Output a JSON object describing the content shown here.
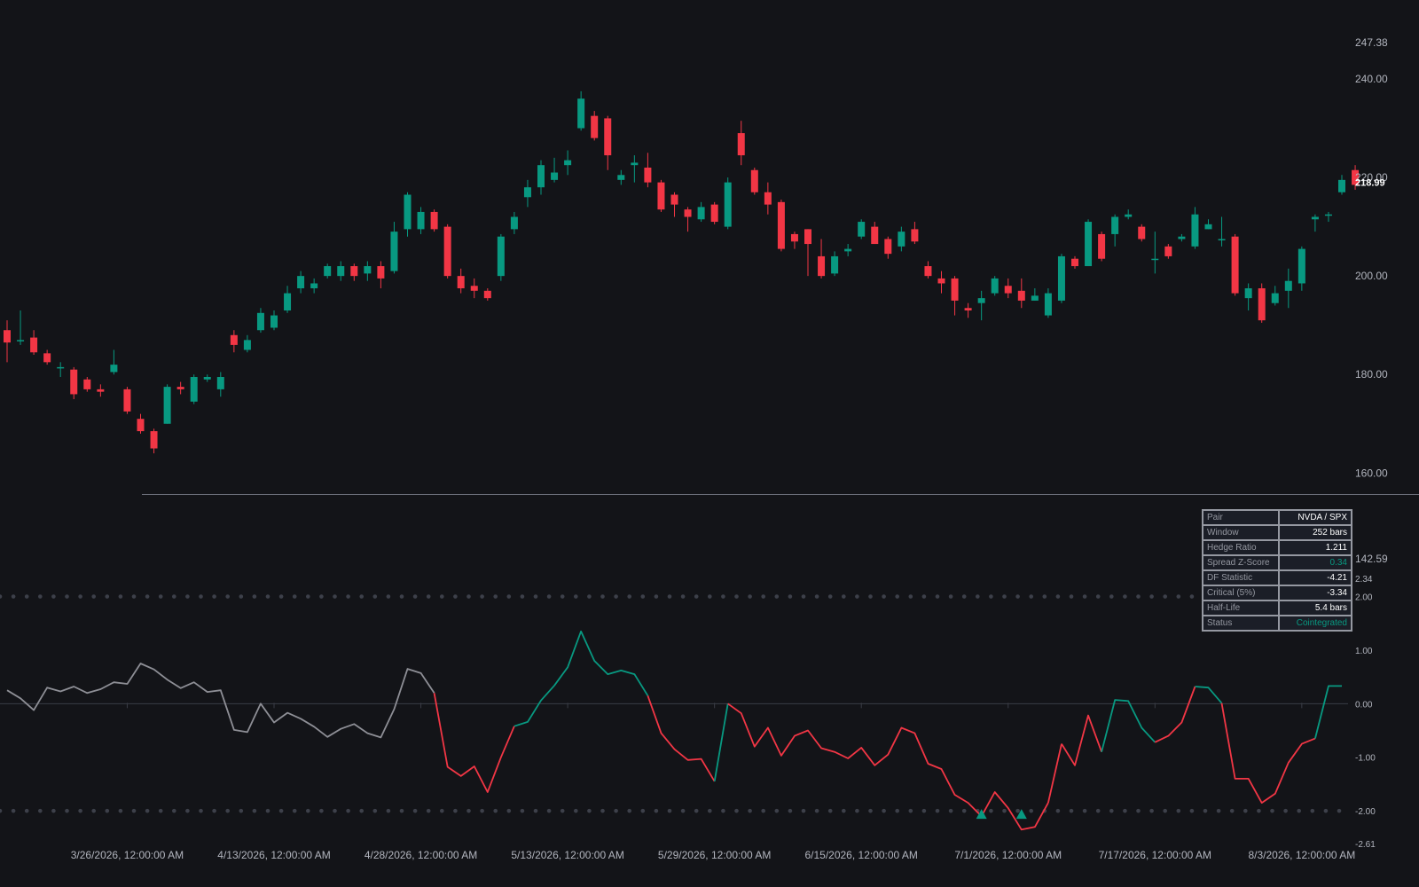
{
  "colors": {
    "background": "#131418",
    "up": "#089981",
    "down": "#f23645",
    "neutral": "#8e8f96",
    "grid": "#3a3d46",
    "band_dots": "#3d404a",
    "table_border": "#9598a1",
    "text": "#b2b5be"
  },
  "stats_table": {
    "rows": [
      {
        "label": "Pair",
        "value": "NVDA / SPX"
      },
      {
        "label": "Window",
        "value": "252 bars"
      },
      {
        "label": "Hedge Ratio",
        "value": "1.211"
      },
      {
        "label": "Spread Z-Score",
        "value": "0.34"
      },
      {
        "label": "DF Statistic",
        "value": "-4.21"
      },
      {
        "label": "Critical (5%)",
        "value": "-3.34"
      },
      {
        "label": "Half-Life",
        "value": "5.4 bars"
      },
      {
        "label": "Status",
        "value": "Cointegrated"
      }
    ]
  },
  "chart_data": [
    {
      "type": "candlestick",
      "title": "",
      "ylim": [
        142.59,
        247.38
      ],
      "y_ticks": [
        "247.38",
        "240.00",
        "220.00",
        "200.00",
        "180.00",
        "160.00",
        "142.59"
      ],
      "last_price": "218.99",
      "candles": [
        [
          189.0,
          186.5,
          191.0,
          182.5
        ],
        [
          187.0,
          187.0,
          193.0,
          186.0
        ],
        [
          187.5,
          184.5,
          189.0,
          184.0
        ],
        [
          184.3,
          182.5,
          185.0,
          182.0
        ],
        [
          181.5,
          181.5,
          182.5,
          179.5
        ],
        [
          181.0,
          176.0,
          181.5,
          175.0
        ],
        [
          179.0,
          177.0,
          179.5,
          176.5
        ],
        [
          177.0,
          176.5,
          178.0,
          175.5
        ],
        [
          180.5,
          182.0,
          185.0,
          180.0
        ],
        [
          177.0,
          172.5,
          177.5,
          172.0
        ],
        [
          171.0,
          168.5,
          172.0,
          168.0
        ],
        [
          168.5,
          165.0,
          169.0,
          164.0
        ],
        [
          170.0,
          177.5,
          178.0,
          170.0
        ],
        [
          177.5,
          177.0,
          178.5,
          176.0
        ],
        [
          174.5,
          179.5,
          180.0,
          174.0
        ],
        [
          179.0,
          179.5,
          180.0,
          178.5
        ],
        [
          177.0,
          179.5,
          180.5,
          175.5
        ],
        [
          188.0,
          186.0,
          189.0,
          184.5
        ],
        [
          185.0,
          187.0,
          188.0,
          184.5
        ],
        [
          189.0,
          192.5,
          193.5,
          188.5
        ],
        [
          189.5,
          192.0,
          193.0,
          189.0
        ],
        [
          193.0,
          196.5,
          198.0,
          192.5
        ],
        [
          197.5,
          200.0,
          201.0,
          196.5
        ],
        [
          197.5,
          198.5,
          199.5,
          196.5
        ],
        [
          200.0,
          202.0,
          202.5,
          199.5
        ],
        [
          200.0,
          202.0,
          203.0,
          199.0
        ],
        [
          202.0,
          200.0,
          202.5,
          199.0
        ],
        [
          200.5,
          202.0,
          203.0,
          199.0
        ],
        [
          202.0,
          199.5,
          203.0,
          197.5
        ],
        [
          201.0,
          209.0,
          211.0,
          200.5
        ],
        [
          209.5,
          216.5,
          217.0,
          208.0
        ],
        [
          209.5,
          213.0,
          214.0,
          208.5
        ],
        [
          213.0,
          209.5,
          213.5,
          209.0
        ],
        [
          210.0,
          200.0,
          210.5,
          199.5
        ],
        [
          200.0,
          197.5,
          201.5,
          196.5
        ],
        [
          198.0,
          197.0,
          199.5,
          195.5
        ],
        [
          197.0,
          195.5,
          197.5,
          195.0
        ],
        [
          200.0,
          208.0,
          208.5,
          199.0
        ],
        [
          209.5,
          212.0,
          213.0,
          208.5
        ],
        [
          216.0,
          218.0,
          219.5,
          214.0
        ],
        [
          218.0,
          222.5,
          223.5,
          216.5
        ],
        [
          219.5,
          221.0,
          224.0,
          219.0
        ],
        [
          222.5,
          223.5,
          225.5,
          220.5
        ],
        [
          230.0,
          236.0,
          237.5,
          229.5
        ],
        [
          232.5,
          228.0,
          233.5,
          227.5
        ],
        [
          232.0,
          224.5,
          232.5,
          221.5
        ],
        [
          219.5,
          220.5,
          221.5,
          218.5
        ],
        [
          222.5,
          223.0,
          224.5,
          219.0
        ],
        [
          222.0,
          219.0,
          225.0,
          218.0
        ],
        [
          219.0,
          213.5,
          219.5,
          213.0
        ],
        [
          216.5,
          214.5,
          217.0,
          212.0
        ],
        [
          213.5,
          212.0,
          214.0,
          209.0
        ],
        [
          211.5,
          214.0,
          215.0,
          211.0
        ],
        [
          214.5,
          211.0,
          215.0,
          210.5
        ],
        [
          210.0,
          219.0,
          220.0,
          209.5
        ],
        [
          229.0,
          224.5,
          231.5,
          222.5
        ],
        [
          221.5,
          217.0,
          222.0,
          216.5
        ],
        [
          217.0,
          214.5,
          219.0,
          212.5
        ],
        [
          215.0,
          205.5,
          215.5,
          205.0
        ],
        [
          208.5,
          207.0,
          209.0,
          205.5
        ],
        [
          209.5,
          206.5,
          209.5,
          200.0
        ],
        [
          204.0,
          200.0,
          207.5,
          199.5
        ],
        [
          200.5,
          204.0,
          205.0,
          200.0
        ],
        [
          205.0,
          205.5,
          206.5,
          204.0
        ],
        [
          208.0,
          211.0,
          211.5,
          207.5
        ],
        [
          210.0,
          206.5,
          211.0,
          206.5
        ],
        [
          207.5,
          204.5,
          208.0,
          203.5
        ],
        [
          206.0,
          209.0,
          210.0,
          205.0
        ],
        [
          209.5,
          207.0,
          211.0,
          206.5
        ],
        [
          202.0,
          200.0,
          203.0,
          199.5
        ],
        [
          199.5,
          198.5,
          201.0,
          196.5
        ],
        [
          199.5,
          195.0,
          200.0,
          192.0
        ],
        [
          193.5,
          193.0,
          194.5,
          191.5
        ],
        [
          194.5,
          195.5,
          197.0,
          191.0
        ],
        [
          196.5,
          199.5,
          200.0,
          196.0
        ],
        [
          198.0,
          196.5,
          199.5,
          195.5
        ],
        [
          197.0,
          195.0,
          199.5,
          193.5
        ],
        [
          195.0,
          196.0,
          197.5,
          195.0
        ],
        [
          192.0,
          196.5,
          197.5,
          191.5
        ],
        [
          195.0,
          204.0,
          204.5,
          194.5
        ],
        [
          203.5,
          202.0,
          204.0,
          201.5
        ],
        [
          202.0,
          211.0,
          211.5,
          202.0
        ],
        [
          208.5,
          203.5,
          209.0,
          203.0
        ],
        [
          208.5,
          212.0,
          212.5,
          206.0
        ],
        [
          212.0,
          212.5,
          213.5,
          211.5
        ],
        [
          210.0,
          207.5,
          210.5,
          207.0
        ],
        [
          203.5,
          203.5,
          209.0,
          200.5
        ],
        [
          206.0,
          204.0,
          206.5,
          203.5
        ],
        [
          207.5,
          208.0,
          208.5,
          207.0
        ],
        [
          206.0,
          212.5,
          214.0,
          205.5
        ],
        [
          209.5,
          210.5,
          211.5,
          209.5
        ],
        [
          207.5,
          207.5,
          212.0,
          206.0
        ],
        [
          208.0,
          196.5,
          208.5,
          196.0
        ],
        [
          195.5,
          197.5,
          198.5,
          193.0
        ],
        [
          197.5,
          191.0,
          198.5,
          190.5
        ],
        [
          194.5,
          196.5,
          198.0,
          194.0
        ],
        [
          197.0,
          199.0,
          201.5,
          193.5
        ],
        [
          198.5,
          205.5,
          206.0,
          197.0
        ],
        [
          211.5,
          212.0,
          212.5,
          209.0
        ],
        [
          212.5,
          212.5,
          213.0,
          211.0
        ],
        [
          217.0,
          219.5,
          220.5,
          216.5
        ],
        [
          221.5,
          218.5,
          222.5,
          217.5
        ]
      ]
    },
    {
      "type": "line",
      "title": "",
      "ylim": [
        -2.61,
        2.34
      ],
      "y_ticks": [
        "2.34",
        "2.00",
        "1.00",
        "0.00",
        "-1.00",
        "-2.00",
        "-2.61"
      ],
      "upper_band": 2.0,
      "lower_band": -2.0,
      "x_tick_labels": [
        "3/26/2026, 12:00:00 AM",
        "4/13/2026, 12:00:00 AM",
        "4/28/2026, 12:00:00 AM",
        "5/13/2026, 12:00:00 AM",
        "5/29/2026, 12:00:00 AM",
        "6/15/2026, 12:00:00 AM",
        "7/1/2026, 12:00:00 AM",
        "7/17/2026, 12:00:00 AM",
        "8/3/2026, 12:00:00 AM"
      ],
      "values": [
        0.25,
        0.1,
        -0.12,
        0.3,
        0.23,
        0.32,
        0.2,
        0.27,
        0.4,
        0.37,
        0.75,
        0.64,
        0.45,
        0.29,
        0.4,
        0.22,
        0.25,
        -0.49,
        -0.53,
        0.0,
        -0.35,
        -0.17,
        -0.28,
        -0.43,
        -0.62,
        -0.47,
        -0.38,
        -0.55,
        -0.63,
        -0.1,
        0.65,
        0.57,
        0.2,
        -1.18,
        -1.35,
        -1.17,
        -1.65,
        -1.0,
        -0.42,
        -0.34,
        0.06,
        0.34,
        0.68,
        1.35,
        0.8,
        0.55,
        0.62,
        0.55,
        0.15,
        -0.55,
        -0.85,
        -1.05,
        -1.03,
        -1.45,
        0.0,
        -0.18,
        -0.8,
        -0.45,
        -0.97,
        -0.6,
        -0.5,
        -0.83,
        -0.9,
        -1.02,
        -0.82,
        -1.15,
        -0.95,
        -0.45,
        -0.55,
        -1.12,
        -1.22,
        -1.7,
        -1.85,
        -2.1,
        -1.65,
        -1.95,
        -2.35,
        -2.3,
        -1.85,
        -0.75,
        -1.15,
        -0.22,
        -0.9,
        0.07,
        0.05,
        -0.45,
        -0.72,
        -0.6,
        -0.35,
        0.32,
        0.3,
        0.01,
        -1.4,
        -1.4,
        -1.85,
        -1.68,
        -1.1,
        -0.75,
        -0.65,
        0.33,
        0.33
      ],
      "trend_segments": [
        {
          "from": 0,
          "to": 32,
          "color": "neutral"
        },
        {
          "from": 32,
          "to": 38,
          "color": "down"
        },
        {
          "from": 38,
          "to": 48,
          "color": "up"
        },
        {
          "from": 48,
          "to": 53,
          "color": "down"
        },
        {
          "from": 53,
          "to": 54,
          "color": "up"
        },
        {
          "from": 54,
          "to": 78,
          "color": "down"
        },
        {
          "from": 78,
          "to": 79,
          "color": "down"
        },
        {
          "from": 79,
          "to": 82,
          "color": "down"
        },
        {
          "from": 82,
          "to": 86,
          "color": "up"
        },
        {
          "from": 86,
          "to": 89,
          "color": "down"
        },
        {
          "from": 89,
          "to": 91,
          "color": "up"
        },
        {
          "from": 91,
          "to": 98,
          "color": "down"
        },
        {
          "from": 98,
          "to": 100,
          "color": "up"
        }
      ],
      "signal_markers": [
        {
          "index": 73,
          "type": "long-entry"
        },
        {
          "index": 76,
          "type": "long-entry"
        }
      ]
    }
  ]
}
